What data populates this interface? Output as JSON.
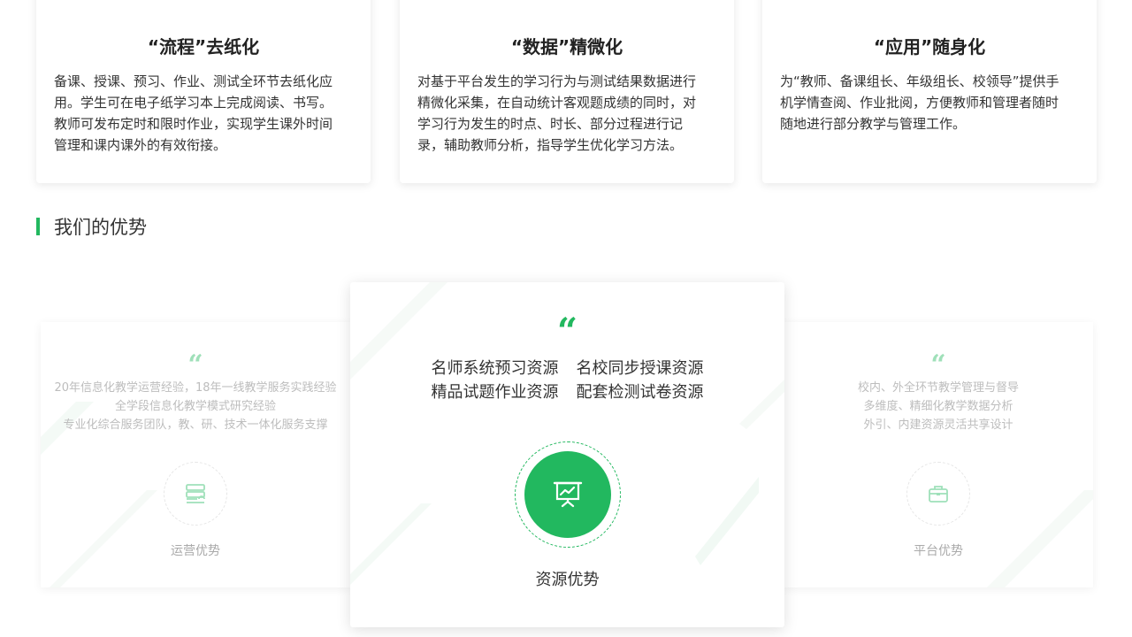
{
  "features": [
    {
      "title": "“流程”去纸化",
      "color": "#f9c43f",
      "lines": [
        "备课、授课、预习、作业、测试全环节去纸化应",
        "用。学生可在电子纸学习本上完成阅读、书写。",
        "教师可发布定时和限时作业，实现学生课外时间",
        "管理和课内课外的有效衔接。"
      ]
    },
    {
      "title": "“数据”精微化",
      "color": "#1e8ff5",
      "lines": [
        "对基于平台发生的学习行为与测试结果数据进行",
        "精微化采集，在自动统计客观题成绩的同时，对",
        "学习行为发生的时点、时长、部分过程进行记",
        "录，辅助教师分析，指导学生优化学习方法。"
      ]
    },
    {
      "title": "“应用”随身化",
      "color": "#22b85f",
      "lines": [
        "为“教师、备课组长、年级组长、校领导”提供手",
        "机学情查阅、作业批阅，方便教师和管理者随时",
        "随地进行部分教学与管理工作。"
      ]
    }
  ],
  "section": {
    "title": "我们的优势"
  },
  "advantages": {
    "left": {
      "quote": "“",
      "icon": "server-icon",
      "lines": [
        "20年信息化教学运营经验，18年一线教学服务实践经验",
        "全学段信息化教学模式研究经验",
        "专业化综合服务团队，教、研、技术一体化服务支撑"
      ],
      "label": "运营优势"
    },
    "center": {
      "quote": "“",
      "icon": "presentation-chart-icon",
      "col1": [
        "名师系统预习资源",
        "精品试题作业资源"
      ],
      "col2": [
        "名校同步授课资源",
        "配套检测试卷资源"
      ],
      "label": "资源优势"
    },
    "right": {
      "quote": "“",
      "icon": "briefcase-icon",
      "lines": [
        "校内、外全环节教学管理与督导",
        "多维度、精细化教学数据分析",
        "外引、内建资源灵活共享设计"
      ],
      "label": "平台优势"
    }
  },
  "colors": {
    "accent": "#22b85f",
    "accent_light": "#9fe0b9"
  }
}
